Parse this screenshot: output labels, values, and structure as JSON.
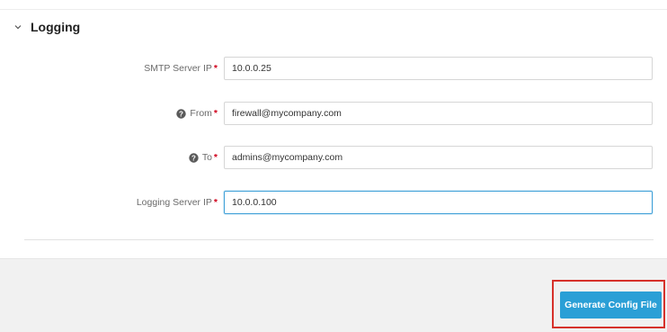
{
  "section": {
    "title": "Logging",
    "collapse_icon": "chevron-down-icon"
  },
  "fields": [
    {
      "label": "SMTP Server IP",
      "required_mark": "*",
      "has_help_icon": false,
      "value": "10.0.0.25"
    },
    {
      "label": "From",
      "required_mark": "*",
      "has_help_icon": true,
      "help_icon": "question-circle-icon",
      "value": "firewall@mycompany.com"
    },
    {
      "label": "To",
      "required_mark": "*",
      "has_help_icon": true,
      "help_icon": "question-circle-icon",
      "value": "admins@mycompany.com"
    },
    {
      "label": "Logging Server IP",
      "required_mark": "*",
      "has_help_icon": false,
      "value": "10.0.0.100",
      "focused": true
    }
  ],
  "footer": {
    "generate_button_label": "Generate Config File"
  },
  "colors": {
    "accent": "#2a9fd6",
    "focus_border": "#3fa0d8",
    "required": "#d0021b",
    "highlight": "#d6312b",
    "footer_bg": "#f1f1f1"
  }
}
